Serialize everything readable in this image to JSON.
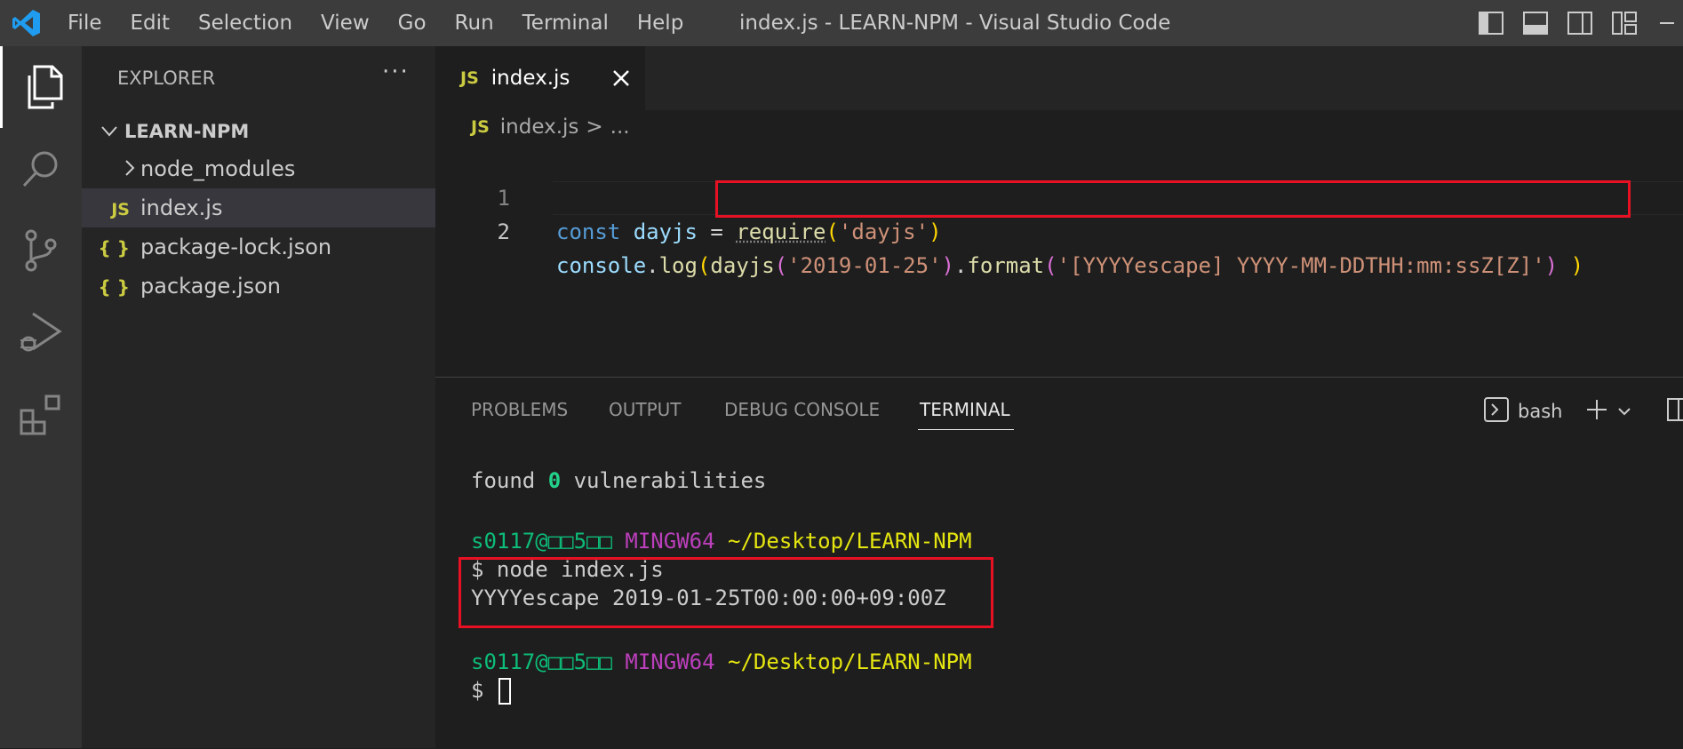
{
  "titlebar": {
    "menu": [
      "File",
      "Edit",
      "Selection",
      "View",
      "Go",
      "Run",
      "Terminal",
      "Help"
    ],
    "window_title": "index.js - LEARN-NPM - Visual Studio Code"
  },
  "activity_bar": [
    "explorer-icon",
    "search-icon",
    "source-control-icon",
    "run-debug-icon",
    "extensions-icon"
  ],
  "sidebar": {
    "title": "EXPLORER",
    "more": "···",
    "folder": "LEARN-NPM",
    "items": [
      {
        "name": "node_modules",
        "type": "folder"
      },
      {
        "name": "index.js",
        "type": "js",
        "badge": "JS"
      },
      {
        "name": "package-lock.json",
        "type": "json",
        "badge": "{ }"
      },
      {
        "name": "package.json",
        "type": "json",
        "badge": "{ }"
      }
    ]
  },
  "editor": {
    "tab": {
      "badge": "JS",
      "name": "index.js"
    },
    "breadcrumb": {
      "badge": "JS",
      "file": "index.js",
      "sep": ">",
      "rest": "..."
    },
    "lines": [
      {
        "num": "1",
        "tokens": {
          "kw": "const",
          "var": "dayjs",
          "eq": " = ",
          "fn": "require",
          "open": "(",
          "str": "'dayjs'",
          "close": ")"
        }
      },
      {
        "num": "2",
        "tokens": {
          "obj": "console",
          "dot": ".",
          "fn": "log",
          "open1": "(",
          "fn2": "dayjs",
          "open2": "(",
          "str1": "'2019-01-25'",
          "close2": ")",
          "dot2": ".",
          "fn3": "format",
          "open3": "(",
          "str2": "'[YYYYescape] YYYY-MM-DDTHH:mm:ssZ[Z]'",
          "close3": ")",
          "close1": ")"
        }
      }
    ]
  },
  "panel": {
    "tabs": [
      "PROBLEMS",
      "OUTPUT",
      "DEBUG CONSOLE",
      "TERMINAL"
    ],
    "active_tab": "TERMINAL",
    "shell": "bash",
    "terminal": {
      "found_a": "found ",
      "found_n": "0",
      "found_b": " vulnerabilities",
      "prompt_user": "s0117@□□5□□",
      "prompt_env": "MINGW64",
      "prompt_path": "~/Desktop/LEARN-NPM",
      "cmd": "$ node index.js",
      "output": "YYYYescape 2019-01-25T00:00:00+09:00Z",
      "prompt_user2": "s0117@□□5□□",
      "prompt_env2": "MINGW64",
      "prompt_path2": "~/Desktop/LEARN-NPM",
      "dollar": "$ "
    }
  }
}
